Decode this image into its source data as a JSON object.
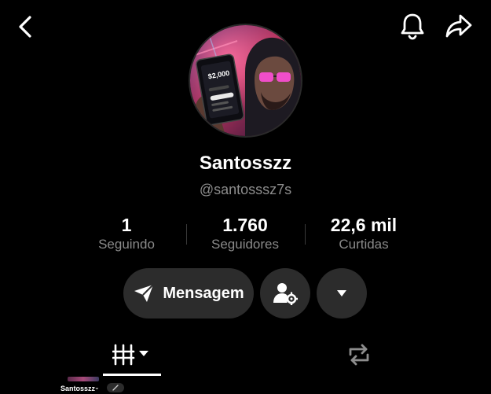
{
  "header": {
    "back_icon": "chevron-left-icon",
    "bell_icon": "bell-icon",
    "share_icon": "share-arrow-icon"
  },
  "profile": {
    "display_name": "Santosszz",
    "username": "@santosssz7s",
    "avatar_phone_amount": "$2,000"
  },
  "stats": [
    {
      "value": "1",
      "label": "Seguindo"
    },
    {
      "value": "1.760",
      "label": "Seguidores"
    },
    {
      "value": "22,6 mil",
      "label": "Curtidas"
    }
  ],
  "actions": {
    "message_label": "Mensagem",
    "message_icon": "paper-plane-icon",
    "follow_settings_icon": "user-settings-icon",
    "more_icon": "caret-down-icon"
  },
  "tabs": {
    "grid_icon": "grid-icon",
    "repost_icon": "repost-icon"
  },
  "mini_bar": {
    "name": "Santosszz",
    "chevron": "⌄"
  },
  "colors": {
    "background": "#000000",
    "pill": "#2c2c2c",
    "secondary_text": "#8a8a8a"
  }
}
